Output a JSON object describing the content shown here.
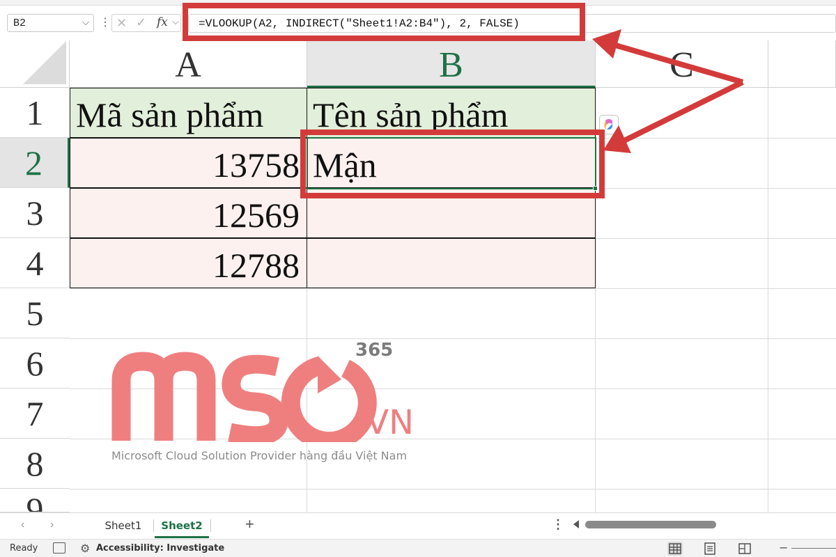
{
  "formula_bar": {
    "name_box": "B2",
    "formula": "=VLOOKUP(A2, INDIRECT(\"Sheet1!A2:B4\"), 2, FALSE)",
    "fx_label": "fx"
  },
  "columns": [
    "A",
    "B",
    "C"
  ],
  "rows": [
    "1",
    "2",
    "3",
    "4",
    "5",
    "6",
    "7",
    "8",
    "9"
  ],
  "table": {
    "header": [
      "Mã sản phẩm",
      "Tên sản phẩm"
    ],
    "body": [
      [
        "13758",
        "Mận"
      ],
      [
        "12569",
        ""
      ],
      [
        "12788",
        ""
      ]
    ]
  },
  "active_cell": "B2",
  "watermark": {
    "brand": "MSO",
    "superscript": "365",
    "domain": ".VN",
    "tagline": "Microsoft Cloud Solution Provider hàng đầu Việt Nam"
  },
  "sheet_tabs": [
    "Sheet1",
    "Sheet2"
  ],
  "active_sheet": "Sheet2",
  "status_bar": {
    "ready": "Ready",
    "accessibility": "Accessibility: Investigate"
  },
  "colors": {
    "highlight": "#d33b3b",
    "excel_green": "#1e7145",
    "header_fill": "#e2efda",
    "data_fill": "#fcf1ee",
    "watermark": "#ef7f7f"
  }
}
